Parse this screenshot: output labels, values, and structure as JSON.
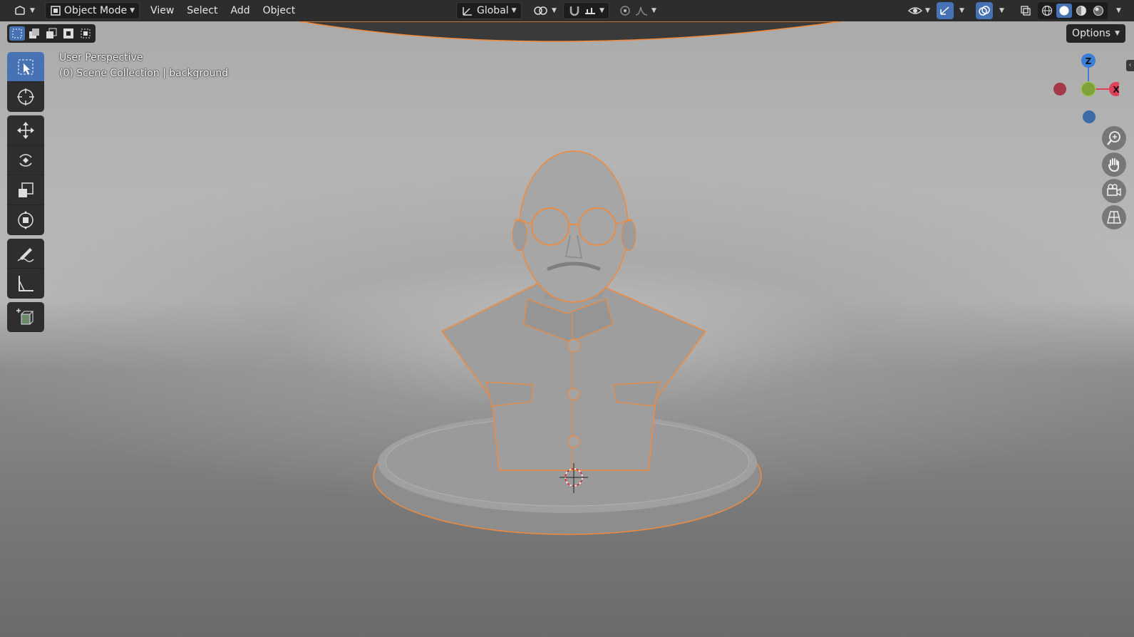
{
  "header": {
    "mode_label": "Object Mode",
    "menus": [
      "View",
      "Select",
      "Add",
      "Object"
    ],
    "transform_orientation": "Global",
    "options_label": "Options"
  },
  "viewport": {
    "perspective_label": "User Perspective",
    "collection_label": "(0) Scene Collection | background"
  },
  "gizmo": {
    "z_label": "Z",
    "x_label": "X"
  },
  "colors": {
    "accent": "#4772b3",
    "selection_outline": "#f08a3c",
    "header_bg": "#2d2d2d",
    "axis_x": "#e0405a",
    "axis_y": "#7ea13a",
    "axis_z": "#3a7fd9"
  },
  "icons": {
    "toolbar": [
      "select-box-icon",
      "cursor-icon",
      "move-icon",
      "rotate-icon",
      "scale-icon",
      "transform-icon",
      "annotate-icon",
      "measure-icon",
      "add-cube-icon"
    ],
    "nav": [
      "zoom-icon",
      "pan-hand-icon",
      "camera-icon",
      "grid-view-icon"
    ]
  }
}
